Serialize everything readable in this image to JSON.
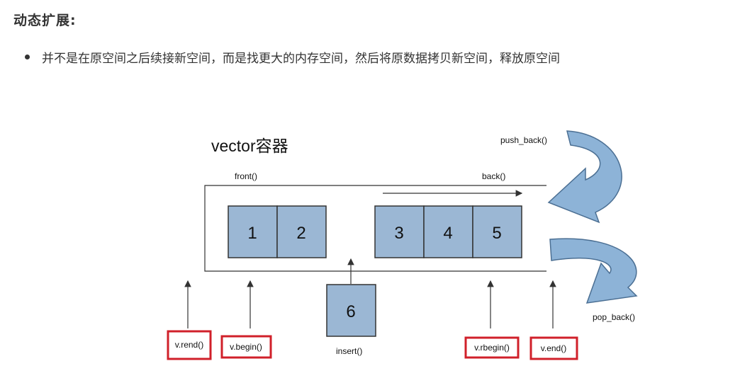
{
  "heading": "动态扩展:",
  "bullet": "并不是在原空间之后续接新空间，而是找更大的内存空间，然后将原数据拷贝新空间，释放原空间",
  "diagram": {
    "title": "vector容器",
    "front_label": "front()",
    "back_label": "back()",
    "push_back_label": "push_back()",
    "pop_back_label": "pop_back()",
    "insert_label": "insert()",
    "cells": [
      "1",
      "2",
      "3",
      "4",
      "5"
    ],
    "insert_cell": "6",
    "iterators": {
      "rend": "v.rend()",
      "begin": "v.begin()",
      "rbegin": "v.rbegin()",
      "end": "v.end()"
    },
    "colors": {
      "cell_fill": "#9bb7d4",
      "curl_arrow": "#8db3d7",
      "highlight_box": "#d0202a"
    }
  }
}
